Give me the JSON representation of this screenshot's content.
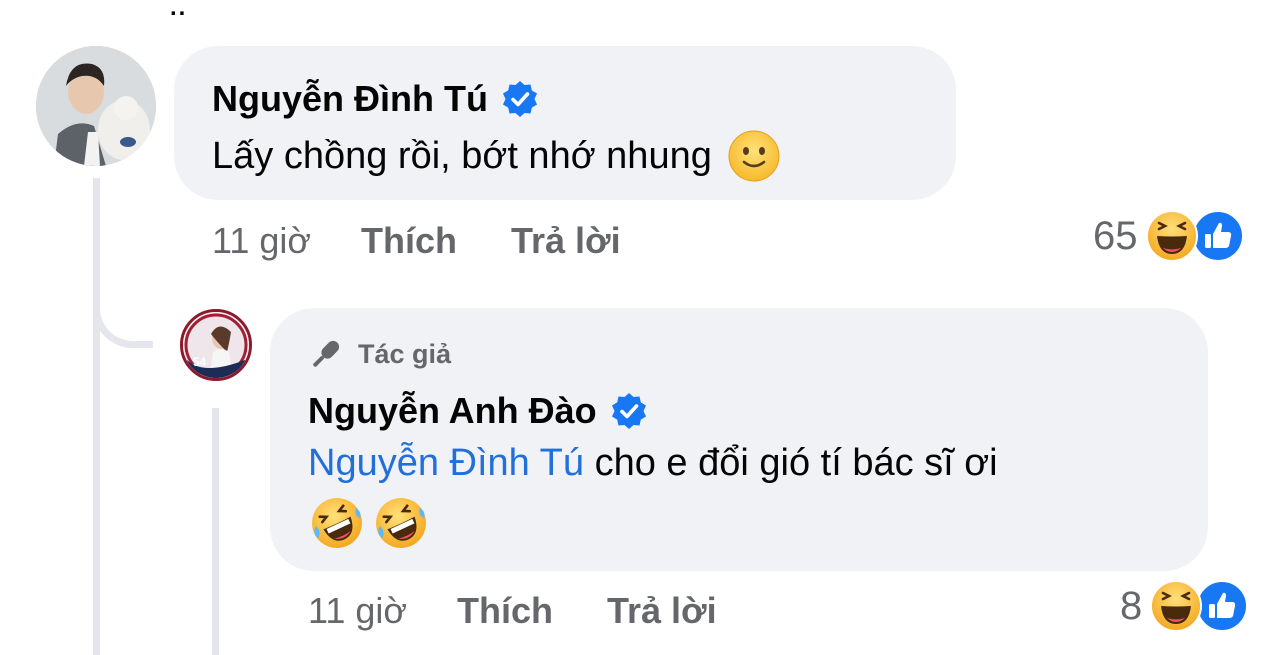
{
  "comment": {
    "author": "Nguyễn Đình Tú",
    "text": "Lấy chồng rồi, bớt nhớ nhung",
    "emoji": "slightly-smiling-face",
    "time": "11 giờ",
    "like_label": "Thích",
    "reply_label": "Trả lời",
    "reaction_count": "65",
    "reactions": [
      "haha-icon",
      "like-icon"
    ]
  },
  "reply": {
    "badge": "Tác giả",
    "author": "Nguyễn Anh Đào",
    "mention": "Nguyễn Đình Tú",
    "text": " cho e đổi gió tí bác sĩ ơi",
    "emojis": [
      "rofl-icon",
      "rofl-icon"
    ],
    "time": "11 giờ",
    "like_label": "Thích",
    "reply_label": "Trả lời",
    "reaction_count": "8",
    "reactions": [
      "haha-icon",
      "like-icon"
    ]
  },
  "colors": {
    "bubble": "#f0f2f5",
    "text": "#050505",
    "secondary": "#65676b",
    "link": "#216fdb",
    "verified": "#1877f2"
  }
}
